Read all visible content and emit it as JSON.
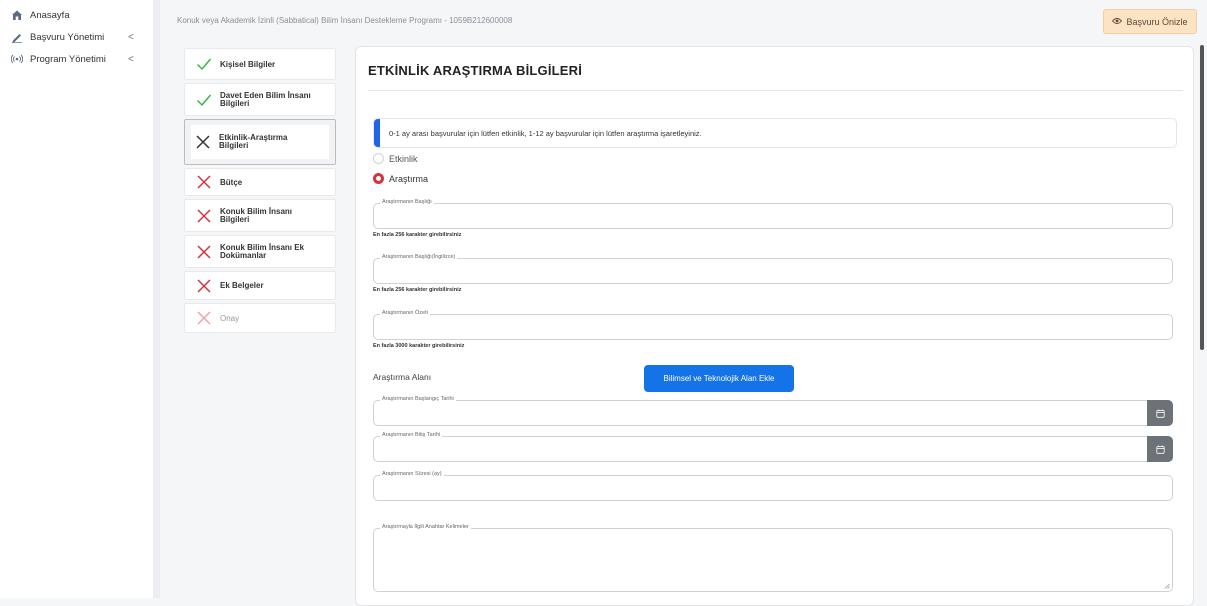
{
  "sidebar": {
    "items": [
      {
        "label": "Anasayfa",
        "icon": "home-icon"
      },
      {
        "label": "Başvuru Yönetimi",
        "icon": "pen-icon",
        "chevron": "<"
      },
      {
        "label": "Program Yönetimi",
        "icon": "broadcast-icon",
        "chevron": "<"
      }
    ]
  },
  "header": {
    "breadcrumb": "Konuk veya Akademik İzinli (Sabbatical) Bilim İnsanı Destekleme Programı - 1059B212600008",
    "preview_button": "Başvuru Önizle"
  },
  "steps": [
    {
      "label": "Kişisel Bilgiler",
      "status": "complete"
    },
    {
      "label": "Davet Eden Bilim İnsanı Bilgileri",
      "status": "complete"
    },
    {
      "label": "Etkinlik-Araştırma Bilgileri",
      "status": "active"
    },
    {
      "label": "Bütçe",
      "status": "incomplete"
    },
    {
      "label": "Konuk Bilim İnsanı Bilgileri",
      "status": "incomplete"
    },
    {
      "label": "Konuk Bilim İnsanı Ek Dokümanlar",
      "status": "incomplete"
    },
    {
      "label": "Ek Belgeler",
      "status": "incomplete"
    },
    {
      "label": "Onay",
      "status": "disabled"
    }
  ],
  "form": {
    "title": "ETKİNLİK ARAŞTIRMA BİLGİLERİ",
    "info_text": "0-1 ay arası başvurular için lütfen etkinlik, 1-12 ay başvurular için lütfen araştırma işaretleyiniz.",
    "radio_options": [
      {
        "label": "Etkinlik",
        "selected": false
      },
      {
        "label": "Araştırma",
        "selected": true
      }
    ],
    "fields": {
      "title_tr": {
        "label": "Araştırmanın Başlığı",
        "value": "",
        "hint": "En fazla 256 karakter girebilirsiniz"
      },
      "title_en": {
        "label": "Araştırmanın Başlığı(İngilizce)",
        "value": "",
        "hint": "En fazla 256 karakter girebilirsiniz"
      },
      "summary": {
        "label": "Araştırmanın Özeti",
        "value": "",
        "hint": "En fazla 3000 karakter girebilirsiniz"
      },
      "start_date": {
        "label": "Araştırmanın Başlangıç Tarihi",
        "value": ""
      },
      "end_date": {
        "label": "Araştırmanın Bitiş Tarihi",
        "value": ""
      },
      "duration": {
        "label": "Araştırmanın Süresi (ay)",
        "value": ""
      },
      "keywords": {
        "label": "Araştırmayla İlgili Anahtar Kelimeler",
        "value": ""
      }
    },
    "area_label": "Araştırma Alanı",
    "area_button": "Bilimsel ve Teknolojik Alan Ekle"
  },
  "colors": {
    "accent_blue": "#1473e6",
    "success_green": "#2fb344",
    "error_red": "#d8323c",
    "preview_button_bg": "#fbe3c3"
  }
}
